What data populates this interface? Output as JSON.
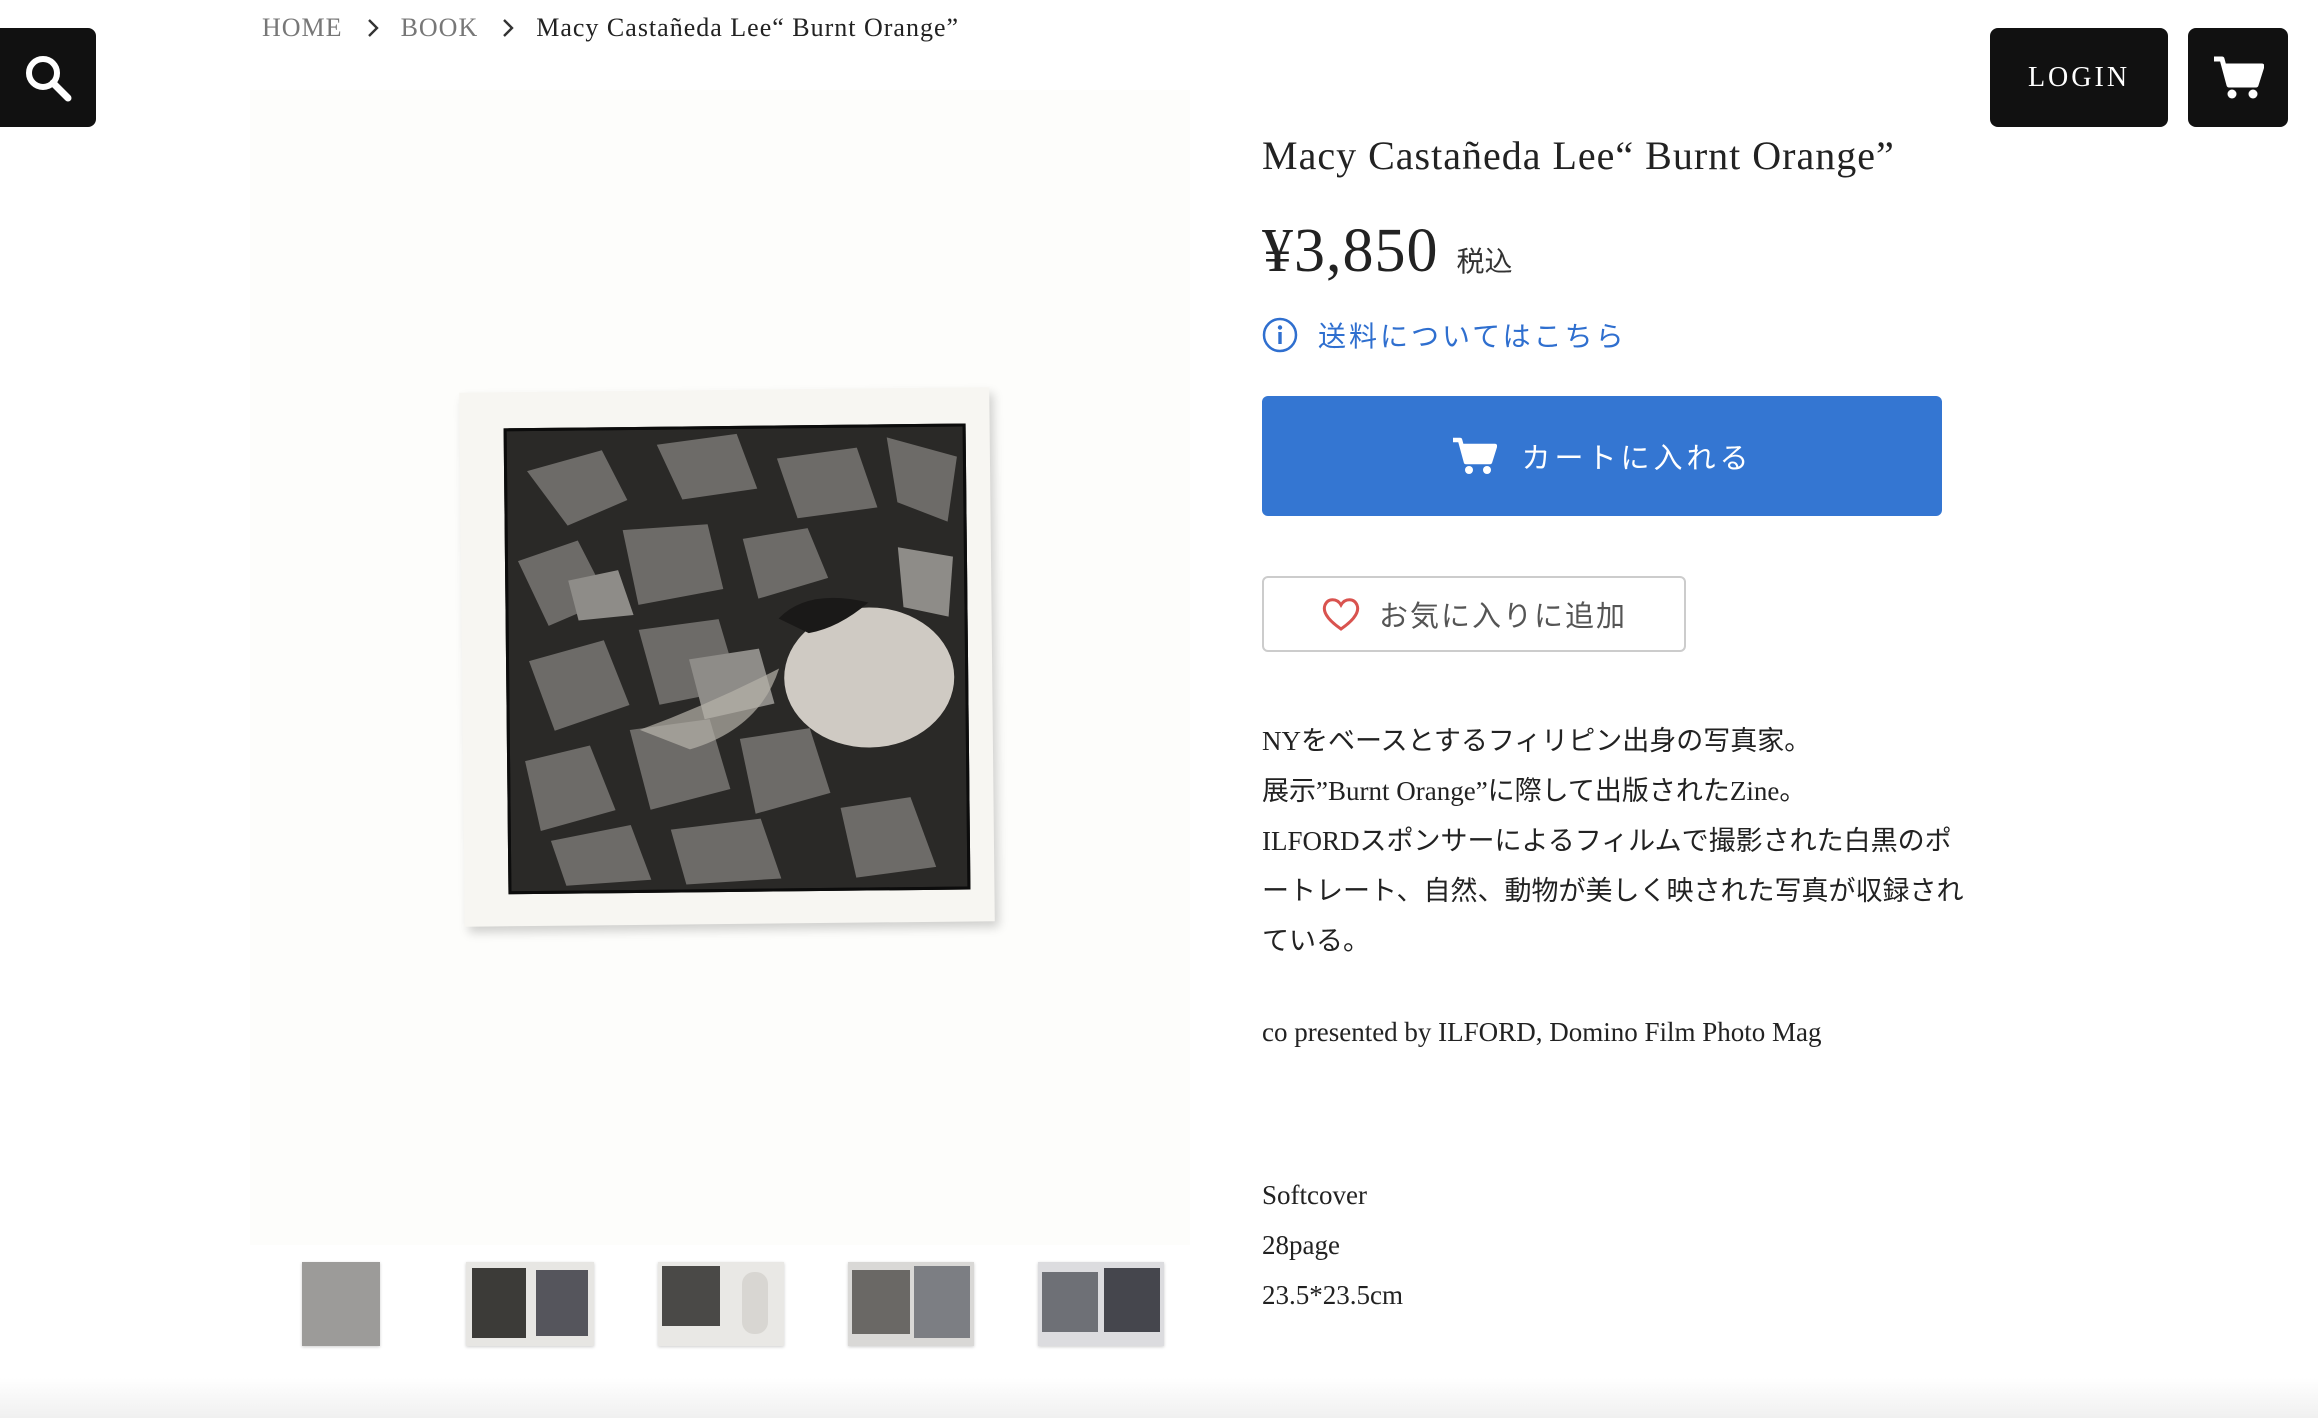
{
  "header": {
    "search_icon": "search-icon",
    "login_label": "LOGIN",
    "cart_icon": "cart-icon"
  },
  "breadcrumb": {
    "items": [
      "HOME",
      "BOOK"
    ],
    "current": "Macy Castañeda Lee“ Burnt Orange”"
  },
  "product": {
    "title": "Macy Castañeda Lee“ Burnt Orange”",
    "price": "¥3,850",
    "tax_label": "税込",
    "shipping_link": "送料についてはこちら",
    "add_to_cart": "カートに入れる",
    "favorite": "お気に入りに追加",
    "description": [
      "NYをベースとするフィリピン出身の写真家。",
      "展示”Burnt Orange”に際して出版されたZine。",
      "ILFORDスポンサーによるフィルムで撮影された白黒のポ",
      "ートレート、自然、動物が美しく映された写真が収録され",
      "ている。"
    ],
    "credit": "co presented by ILFORD, Domino Film Photo Mag",
    "specs": [
      "Softcover",
      "28page",
      "23.5*23.5cm"
    ]
  },
  "colors": {
    "accent": "#3476d2",
    "link": "#2f6fcf",
    "dark": "#111111",
    "heart": "#d9534f"
  }
}
